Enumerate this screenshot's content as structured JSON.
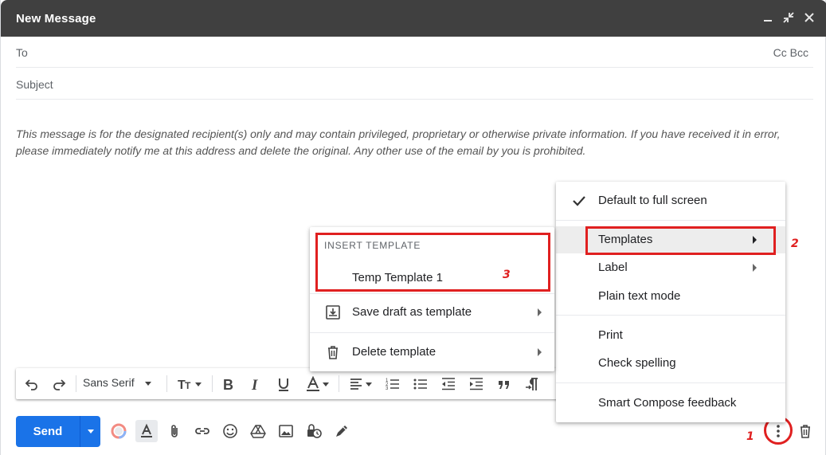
{
  "window": {
    "title": "New Message"
  },
  "compose": {
    "to_label": "To",
    "cc_bcc": "Cc Bcc",
    "subject_placeholder": "Subject",
    "body": "This message is for the designated recipient(s) only and may contain privileged, proprietary or otherwise private information. If you have received it in error, please immediately notify me at this address and delete the original. Any other use of the email by you is prohibited."
  },
  "toolbar": {
    "font": "Sans Serif"
  },
  "send": {
    "label": "Send"
  },
  "more_menu": {
    "items": [
      {
        "label": "Default to full screen",
        "checked": true
      },
      {
        "label": "Templates",
        "submenu": true,
        "highlighted": true
      },
      {
        "label": "Label",
        "submenu": true
      },
      {
        "label": "Plain text mode"
      },
      {
        "label": "Print"
      },
      {
        "label": "Check spelling"
      },
      {
        "label": "Smart Compose feedback"
      }
    ]
  },
  "templates_menu": {
    "header": "INSERT TEMPLATE",
    "items": [
      {
        "label": "Temp Template 1"
      },
      {
        "label": "Save draft as template",
        "submenu": true
      },
      {
        "label": "Delete template",
        "submenu": true
      }
    ]
  },
  "annotations": {
    "step1": "1",
    "step2": "2",
    "step3": "3",
    "color": "#e02020"
  },
  "colors": {
    "titlebar": "#404040",
    "send": "#1a73e8"
  }
}
